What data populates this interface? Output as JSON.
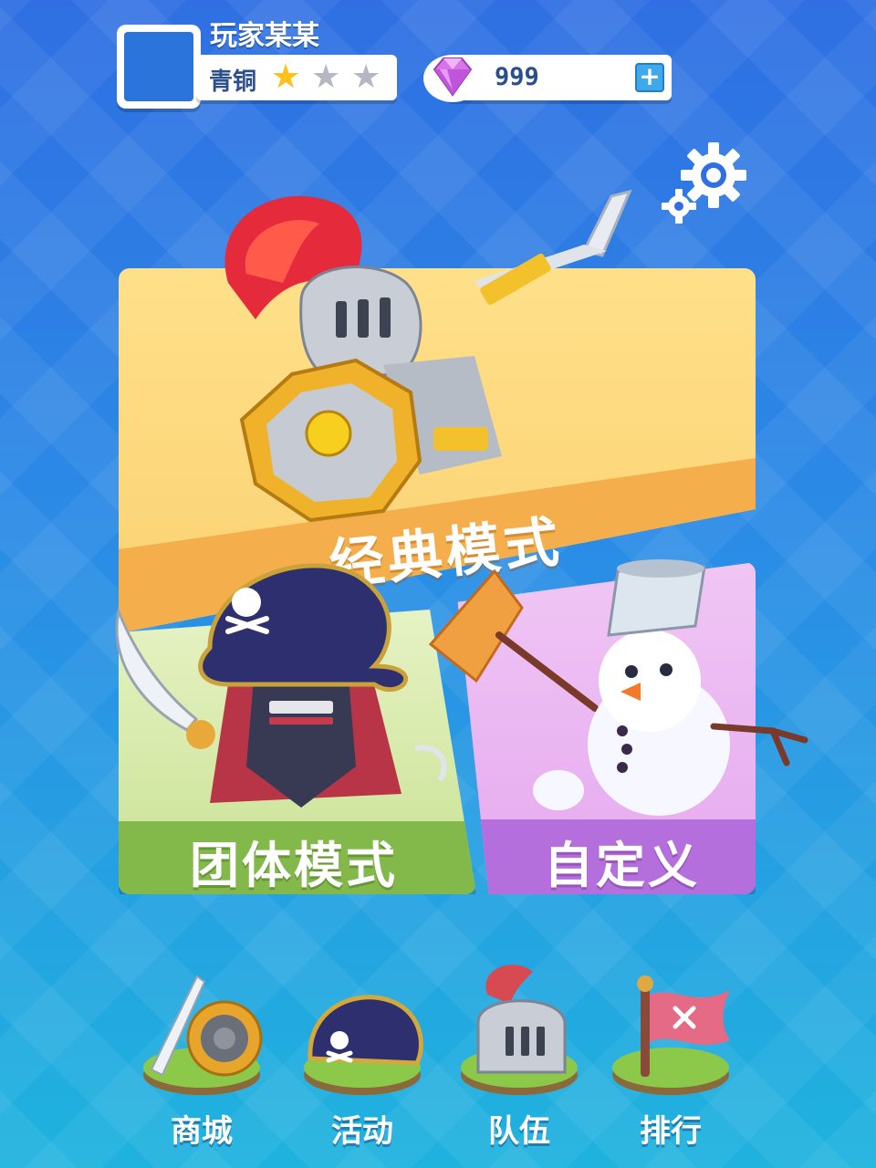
{
  "player": {
    "name": "玩家某某",
    "rank": "青铜",
    "stars_filled": 1,
    "stars_total": 3
  },
  "currency": {
    "gems": "999",
    "add_icon": "plus-icon",
    "gem_icon": "diamond-icon"
  },
  "settings": {
    "icon": "gear-icon"
  },
  "modes": {
    "classic": {
      "label": "经典模式",
      "color": "#f5ae4c"
    },
    "team": {
      "label": "团体模式",
      "color": "#83b84b"
    },
    "custom": {
      "label": "自定义",
      "color": "#b46fdc"
    }
  },
  "nav": {
    "shop": {
      "label": "商城",
      "icon": "shield-sword-icon"
    },
    "events": {
      "label": "活动",
      "icon": "pirate-hat-icon"
    },
    "team": {
      "label": "队伍",
      "icon": "knight-helmet-icon"
    },
    "rank": {
      "label": "排行",
      "icon": "flag-icon"
    }
  }
}
